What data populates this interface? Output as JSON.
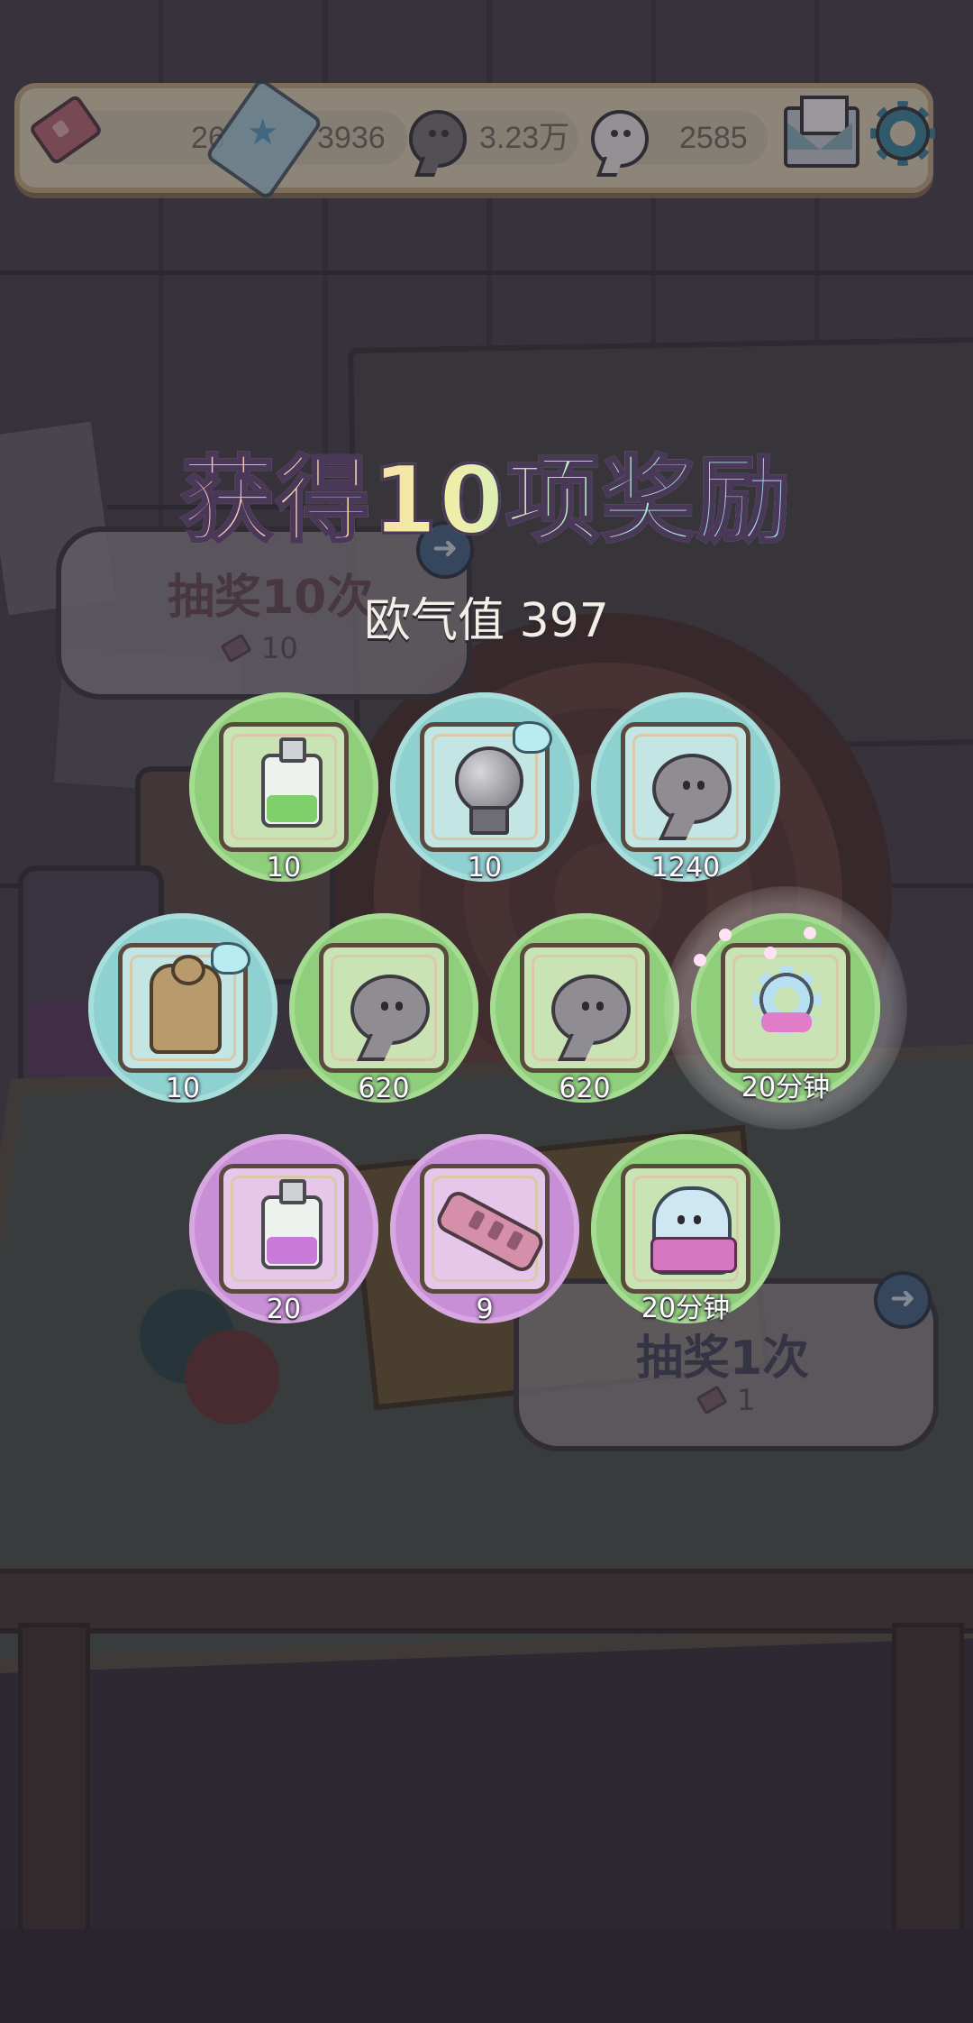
{
  "top_bar": {
    "tickets": "26",
    "star_tickets": "3936",
    "gray_souls": "3.23万",
    "white_souls": "2585"
  },
  "dialog": {
    "title": "获得10项奖励",
    "luck_label": "欧气值 397"
  },
  "rewards": [
    {
      "item": "green-potion-bottle",
      "qty": "10",
      "rarity": "green"
    },
    {
      "item": "crystal-ball-statue",
      "qty": "10",
      "rarity": "teal"
    },
    {
      "item": "gray-ghost-soul",
      "qty": "1240",
      "rarity": "teal"
    },
    {
      "item": "golden-statue",
      "qty": "10",
      "rarity": "teal"
    },
    {
      "item": "gray-ghost-soul",
      "qty": "620",
      "rarity": "green"
    },
    {
      "item": "gray-ghost-soul",
      "qty": "620",
      "rarity": "green"
    },
    {
      "item": "gear-boost",
      "qty": "20分钟",
      "rarity": "green"
    },
    {
      "item": "purple-potion-bottle",
      "qty": "20",
      "rarity": "purple"
    },
    {
      "item": "pink-cannon",
      "qty": "9",
      "rarity": "purple"
    },
    {
      "item": "ghost-cloak-boost",
      "qty": "20分钟",
      "rarity": "green"
    }
  ],
  "draw_buttons": {
    "ten": {
      "label": "抽奖10次",
      "cost": "10"
    },
    "one": {
      "label": "抽奖1次",
      "cost": "1"
    }
  },
  "colors": {
    "green": "#8fcf7c",
    "teal": "#8fd1d0",
    "purple": "#c98fd6"
  }
}
